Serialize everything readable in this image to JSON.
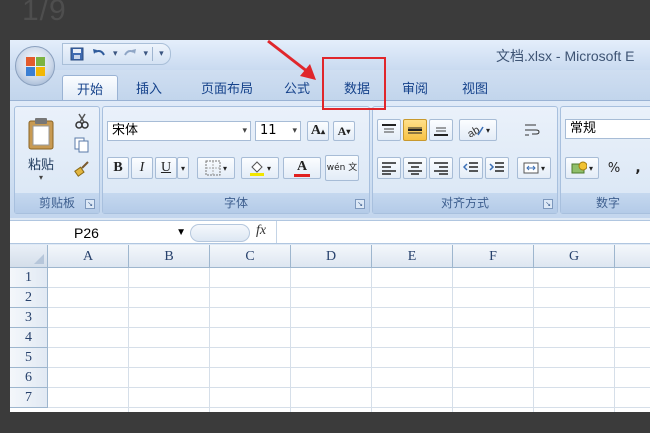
{
  "page_number": "1/9",
  "titlebar": {
    "title": "文档.xlsx - Microsoft E",
    "qat": {
      "save_icon": "save-icon",
      "undo_icon": "undo-icon",
      "redo_icon": "redo-icon",
      "customize_icon": "customize-dropdown-icon"
    }
  },
  "tabs": [
    {
      "label": "开始",
      "active": true
    },
    {
      "label": "插入",
      "active": false
    },
    {
      "label": "页面布局",
      "active": false
    },
    {
      "label": "公式",
      "active": false
    },
    {
      "label": "数据",
      "active": false
    },
    {
      "label": "审阅",
      "active": false
    },
    {
      "label": "视图",
      "active": false
    }
  ],
  "ribbon": {
    "clipboard": {
      "label": "剪贴板",
      "paste_label": "粘贴"
    },
    "font": {
      "label": "字体",
      "font_name": "宋体",
      "font_size": "11",
      "bold": "B",
      "italic": "I",
      "underline": "U",
      "grow_font": "A",
      "shrink_font": "A",
      "font_color": "A",
      "phonetic": "wén 文"
    },
    "alignment": {
      "label": "对齐方式"
    },
    "number": {
      "label": "数字",
      "format": "常规",
      "percent": "%",
      "comma": ","
    }
  },
  "formula_bar": {
    "name_box": "P26",
    "fx": "fx",
    "formula": ""
  },
  "grid": {
    "columns": [
      "A",
      "B",
      "C",
      "D",
      "E",
      "F",
      "G"
    ],
    "rows": [
      "1",
      "2",
      "3",
      "4",
      "5",
      "6",
      "7"
    ]
  },
  "colors": {
    "annotation": "#e0262b",
    "tab_text": "#15428b"
  }
}
